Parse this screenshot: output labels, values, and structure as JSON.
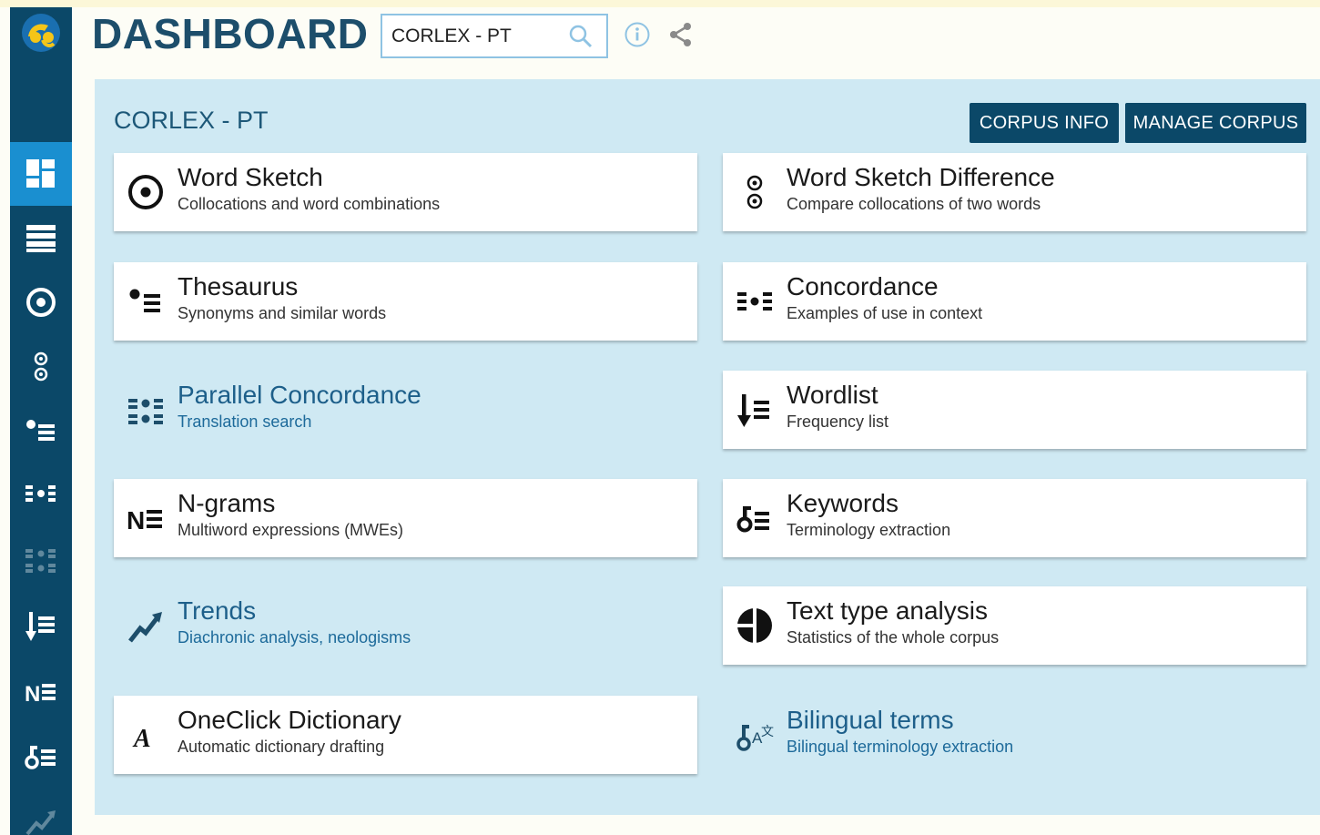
{
  "header": {
    "title": "DASHBOARD",
    "search_value": "CORLEX - PT",
    "info_icon": "info-icon",
    "share_icon": "share-icon"
  },
  "sidebar": {
    "items": [
      {
        "icon": "dashboard-icon",
        "active": true
      },
      {
        "icon": "list-icon"
      },
      {
        "icon": "word-sketch-icon"
      },
      {
        "icon": "word-sketch-difference-icon"
      },
      {
        "icon": "thesaurus-icon"
      },
      {
        "icon": "concordance-icon"
      },
      {
        "icon": "parallel-concordance-icon",
        "disabled": true
      },
      {
        "icon": "wordlist-icon"
      },
      {
        "icon": "ngrams-icon"
      },
      {
        "icon": "keywords-icon"
      },
      {
        "icon": "trends-icon",
        "disabled": true
      }
    ]
  },
  "panel": {
    "corpus_name": "CORLEX - PT",
    "corpus_info_label": "CORPUS INFO",
    "manage_corpus_label": "MANAGE CORPUS"
  },
  "tools": [
    {
      "name": "Word Sketch",
      "desc": "Collocations and word combinations",
      "icon": "word-sketch-icon"
    },
    {
      "name": "Word Sketch Difference",
      "desc": "Compare collocations of two words",
      "icon": "word-sketch-difference-icon"
    },
    {
      "name": "Thesaurus",
      "desc": "Synonyms and similar words",
      "icon": "thesaurus-icon"
    },
    {
      "name": "Concordance",
      "desc": "Examples of use in context",
      "icon": "concordance-icon"
    },
    {
      "name": "Parallel Concordance",
      "desc": "Translation search",
      "icon": "parallel-concordance-icon"
    },
    {
      "name": "Wordlist",
      "desc": "Frequency list",
      "icon": "wordlist-icon"
    },
    {
      "name": "N-grams",
      "desc": "Multiword expressions (MWEs)",
      "icon": "ngrams-icon"
    },
    {
      "name": "Keywords",
      "desc": "Terminology extraction",
      "icon": "keywords-icon"
    },
    {
      "name": "Trends",
      "desc": "Diachronic analysis, neologisms",
      "icon": "trends-icon"
    },
    {
      "name": "Text type analysis",
      "desc": "Statistics of the whole corpus",
      "icon": "text-type-analysis-icon"
    },
    {
      "name": "OneClick Dictionary",
      "desc": "Automatic dictionary drafting",
      "icon": "oneclick-dictionary-icon"
    },
    {
      "name": "Bilingual terms",
      "desc": "Bilingual terminology extraction",
      "icon": "bilingual-terms-icon"
    }
  ],
  "colors": {
    "sidebar": "#0b4868",
    "sidebar_active": "#1a8fd0",
    "panel": "#cfe9f3",
    "button": "#0b4868",
    "title": "#1d4e6b"
  }
}
